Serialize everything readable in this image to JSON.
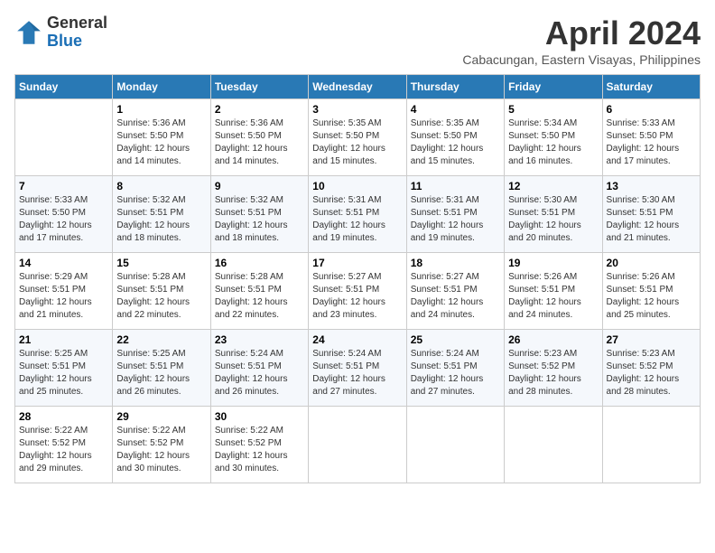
{
  "header": {
    "logo": {
      "line1": "General",
      "line2": "Blue"
    },
    "title": "April 2024",
    "location": "Cabacungan, Eastern Visayas, Philippines"
  },
  "weekdays": [
    "Sunday",
    "Monday",
    "Tuesday",
    "Wednesday",
    "Thursday",
    "Friday",
    "Saturday"
  ],
  "weeks": [
    [
      {
        "day": "",
        "info": ""
      },
      {
        "day": "1",
        "info": "Sunrise: 5:36 AM\nSunset: 5:50 PM\nDaylight: 12 hours\nand 14 minutes."
      },
      {
        "day": "2",
        "info": "Sunrise: 5:36 AM\nSunset: 5:50 PM\nDaylight: 12 hours\nand 14 minutes."
      },
      {
        "day": "3",
        "info": "Sunrise: 5:35 AM\nSunset: 5:50 PM\nDaylight: 12 hours\nand 15 minutes."
      },
      {
        "day": "4",
        "info": "Sunrise: 5:35 AM\nSunset: 5:50 PM\nDaylight: 12 hours\nand 15 minutes."
      },
      {
        "day": "5",
        "info": "Sunrise: 5:34 AM\nSunset: 5:50 PM\nDaylight: 12 hours\nand 16 minutes."
      },
      {
        "day": "6",
        "info": "Sunrise: 5:33 AM\nSunset: 5:50 PM\nDaylight: 12 hours\nand 17 minutes."
      }
    ],
    [
      {
        "day": "7",
        "info": "Sunrise: 5:33 AM\nSunset: 5:50 PM\nDaylight: 12 hours\nand 17 minutes."
      },
      {
        "day": "8",
        "info": "Sunrise: 5:32 AM\nSunset: 5:51 PM\nDaylight: 12 hours\nand 18 minutes."
      },
      {
        "day": "9",
        "info": "Sunrise: 5:32 AM\nSunset: 5:51 PM\nDaylight: 12 hours\nand 18 minutes."
      },
      {
        "day": "10",
        "info": "Sunrise: 5:31 AM\nSunset: 5:51 PM\nDaylight: 12 hours\nand 19 minutes."
      },
      {
        "day": "11",
        "info": "Sunrise: 5:31 AM\nSunset: 5:51 PM\nDaylight: 12 hours\nand 19 minutes."
      },
      {
        "day": "12",
        "info": "Sunrise: 5:30 AM\nSunset: 5:51 PM\nDaylight: 12 hours\nand 20 minutes."
      },
      {
        "day": "13",
        "info": "Sunrise: 5:30 AM\nSunset: 5:51 PM\nDaylight: 12 hours\nand 21 minutes."
      }
    ],
    [
      {
        "day": "14",
        "info": "Sunrise: 5:29 AM\nSunset: 5:51 PM\nDaylight: 12 hours\nand 21 minutes."
      },
      {
        "day": "15",
        "info": "Sunrise: 5:28 AM\nSunset: 5:51 PM\nDaylight: 12 hours\nand 22 minutes."
      },
      {
        "day": "16",
        "info": "Sunrise: 5:28 AM\nSunset: 5:51 PM\nDaylight: 12 hours\nand 22 minutes."
      },
      {
        "day": "17",
        "info": "Sunrise: 5:27 AM\nSunset: 5:51 PM\nDaylight: 12 hours\nand 23 minutes."
      },
      {
        "day": "18",
        "info": "Sunrise: 5:27 AM\nSunset: 5:51 PM\nDaylight: 12 hours\nand 24 minutes."
      },
      {
        "day": "19",
        "info": "Sunrise: 5:26 AM\nSunset: 5:51 PM\nDaylight: 12 hours\nand 24 minutes."
      },
      {
        "day": "20",
        "info": "Sunrise: 5:26 AM\nSunset: 5:51 PM\nDaylight: 12 hours\nand 25 minutes."
      }
    ],
    [
      {
        "day": "21",
        "info": "Sunrise: 5:25 AM\nSunset: 5:51 PM\nDaylight: 12 hours\nand 25 minutes."
      },
      {
        "day": "22",
        "info": "Sunrise: 5:25 AM\nSunset: 5:51 PM\nDaylight: 12 hours\nand 26 minutes."
      },
      {
        "day": "23",
        "info": "Sunrise: 5:24 AM\nSunset: 5:51 PM\nDaylight: 12 hours\nand 26 minutes."
      },
      {
        "day": "24",
        "info": "Sunrise: 5:24 AM\nSunset: 5:51 PM\nDaylight: 12 hours\nand 27 minutes."
      },
      {
        "day": "25",
        "info": "Sunrise: 5:24 AM\nSunset: 5:51 PM\nDaylight: 12 hours\nand 27 minutes."
      },
      {
        "day": "26",
        "info": "Sunrise: 5:23 AM\nSunset: 5:52 PM\nDaylight: 12 hours\nand 28 minutes."
      },
      {
        "day": "27",
        "info": "Sunrise: 5:23 AM\nSunset: 5:52 PM\nDaylight: 12 hours\nand 28 minutes."
      }
    ],
    [
      {
        "day": "28",
        "info": "Sunrise: 5:22 AM\nSunset: 5:52 PM\nDaylight: 12 hours\nand 29 minutes."
      },
      {
        "day": "29",
        "info": "Sunrise: 5:22 AM\nSunset: 5:52 PM\nDaylight: 12 hours\nand 30 minutes."
      },
      {
        "day": "30",
        "info": "Sunrise: 5:22 AM\nSunset: 5:52 PM\nDaylight: 12 hours\nand 30 minutes."
      },
      {
        "day": "",
        "info": ""
      },
      {
        "day": "",
        "info": ""
      },
      {
        "day": "",
        "info": ""
      },
      {
        "day": "",
        "info": ""
      }
    ]
  ]
}
